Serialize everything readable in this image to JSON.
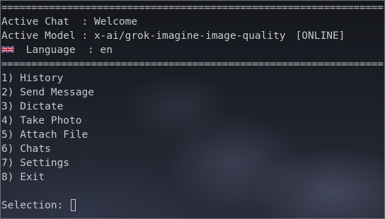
{
  "separator": "=========================================================================",
  "info": {
    "chat_label": "Active Chat  : ",
    "chat_value": "Welcome",
    "model_label": "Active Model : ",
    "model_value": "x-ai/grok-imagine-image-quality",
    "model_status": "[ONLINE]",
    "language_flag": "uk-flag-icon",
    "language_label": " Language  : ",
    "language_value": "en"
  },
  "menu": [
    {
      "num": "1)",
      "label": "History"
    },
    {
      "num": "2)",
      "label": "Send Message"
    },
    {
      "num": "3)",
      "label": "Dictate"
    },
    {
      "num": "4)",
      "label": "Take Photo"
    },
    {
      "num": "5)",
      "label": "Attach File"
    },
    {
      "num": "6)",
      "label": "Chats"
    },
    {
      "num": "7)",
      "label": "Settings"
    },
    {
      "num": "8)",
      "label": "Exit"
    }
  ],
  "prompt": {
    "label": "Selection: ",
    "value": ""
  }
}
